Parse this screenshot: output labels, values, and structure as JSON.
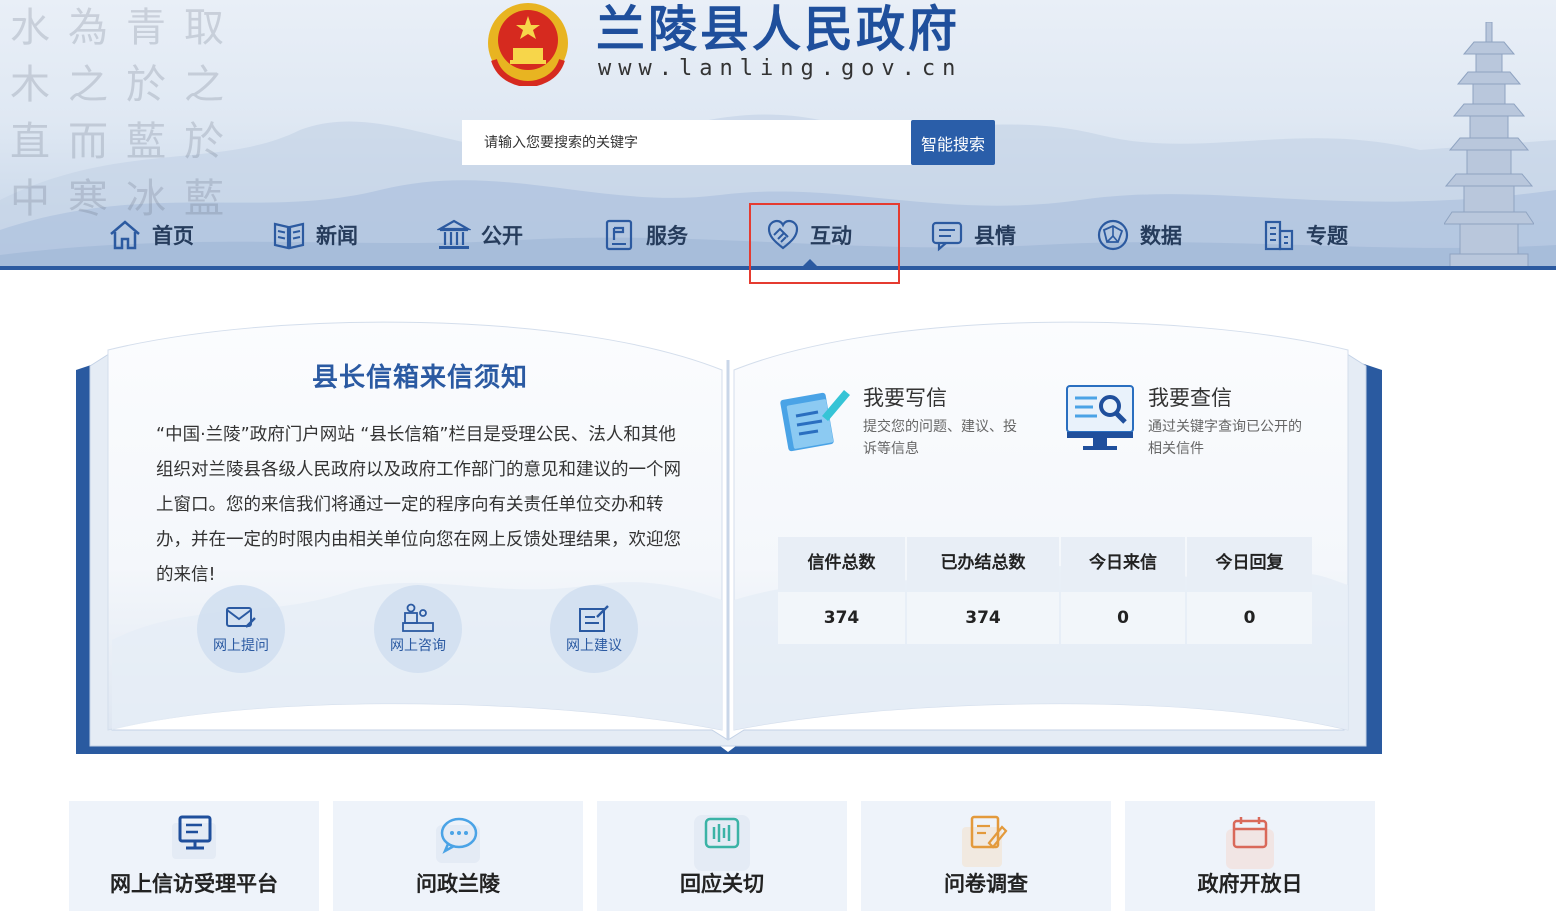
{
  "header": {
    "site_title": "兰陵县人民政府",
    "site_url": "www.lanling.gov.cn",
    "calligraphy": "水為青取木之於之直而藍於中寒冰藍"
  },
  "search": {
    "placeholder": "请输入您要搜索的关键字",
    "button_label": "智能搜索"
  },
  "nav": {
    "active": "互动",
    "items": [
      {
        "label": "首页",
        "icon": "home-icon"
      },
      {
        "label": "新闻",
        "icon": "newspaper-icon"
      },
      {
        "label": "公开",
        "icon": "building-icon"
      },
      {
        "label": "服务",
        "icon": "service-doc-icon"
      },
      {
        "label": "互动",
        "icon": "handshake-icon"
      },
      {
        "label": "县情",
        "icon": "chat-icon"
      },
      {
        "label": "数据",
        "icon": "globe-data-icon"
      },
      {
        "label": "专题",
        "icon": "city-icon"
      }
    ]
  },
  "notice": {
    "title": "县长信箱来信须知",
    "text": "“中国·兰陵”政府门户网站 “县长信箱”栏目是受理公民、法人和其他组织对兰陵县各级人民政府以及政府工作部门的意见和建议的一个网上窗口。您的来信我们将通过一定的程序向有关责任单位交办和转办，并在一定的时限内由相关单位向您在网上反馈处理结果，欢迎您的来信!"
  },
  "bubbles": [
    {
      "label": "网上提问",
      "icon": "mail-edit-icon"
    },
    {
      "label": "网上咨询",
      "icon": "consult-desk-icon"
    },
    {
      "label": "网上建议",
      "icon": "suggest-edit-icon"
    }
  ],
  "actions": {
    "write": {
      "title": "我要写信",
      "desc": "提交您的问题、建议、投诉等信息",
      "icon": "write-letter-icon"
    },
    "query": {
      "title": "我要查信",
      "desc": "通过关键字查询已公开的相关信件",
      "icon": "query-letter-icon"
    }
  },
  "stats": [
    {
      "label": "信件总数",
      "value": "374"
    },
    {
      "label": "已办结总数",
      "value": "374"
    },
    {
      "label": "今日来信",
      "value": "0"
    },
    {
      "label": "今日回复",
      "value": "0"
    }
  ],
  "cards": [
    {
      "label": "网上信访受理平台",
      "icon": "monitor-icon"
    },
    {
      "label": "问政兰陵",
      "icon": "chat-bubble-icon"
    },
    {
      "label": "回应关切",
      "icon": "audio-wave-icon"
    },
    {
      "label": "问卷调查",
      "icon": "survey-edit-icon"
    },
    {
      "label": "政府开放日",
      "icon": "calendar-icon"
    }
  ],
  "colors": {
    "brand_blue": "#2c5aa0",
    "title_blue": "#1f4f9c",
    "highlight_red": "#e53b30"
  }
}
